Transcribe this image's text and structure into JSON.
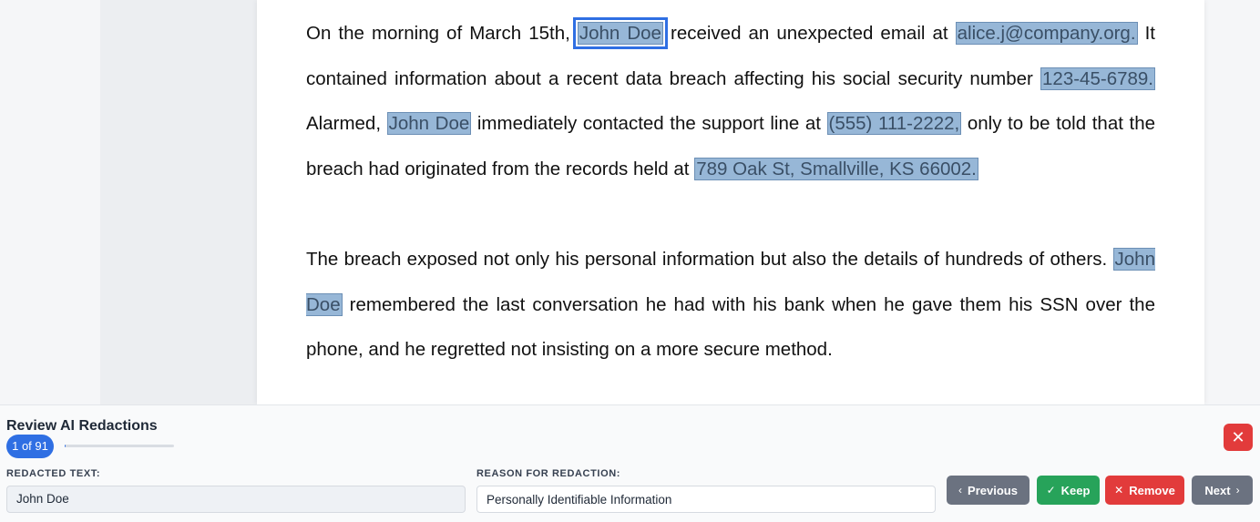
{
  "document": {
    "p1": {
      "t1": "On the morning of March 15th, ",
      "r1": "John Doe",
      "t2": " received an unexpected email at ",
      "r2": "alice.j@company.org.",
      "t3": " It contained information about a recent data breach affecting his social security number ",
      "r3": "123-45-6789.",
      "t4": " Alarmed, ",
      "r4": "John Doe",
      "t5": " immediately contacted the support line at ",
      "r5": "(555) 111-2222,",
      "t6": " only to be told that the breach had originated from the records held at ",
      "r6": "789 Oak St, Smallville, KS 66002."
    },
    "p2": {
      "t1": "The breach exposed not only his personal information but also the details of hundreds of others. ",
      "r1": "John Doe",
      "t2": " remembered the last conversation he had with his bank when he gave them his SSN over the phone, and he regretted not insisting on a more secure method."
    }
  },
  "review_panel": {
    "title": "Review AI Redactions",
    "counter": "1 of 91",
    "progress_fraction": 0.011,
    "close_icon": "close-icon",
    "redacted_text_label": "REDACTED TEXT:",
    "redacted_text_value": "John Doe",
    "reason_label": "REASON FOR REDACTION:",
    "reason_value": "Personally Identifiable Information",
    "buttons": {
      "previous": "Previous",
      "keep": "Keep",
      "remove": "Remove",
      "next": "Next"
    }
  },
  "colors": {
    "redaction_highlight": "#97b7d7",
    "active_outline": "#2f6fe3",
    "keep": "#27a35a",
    "remove": "#e23b3b",
    "neutral_button": "#6b7280"
  }
}
